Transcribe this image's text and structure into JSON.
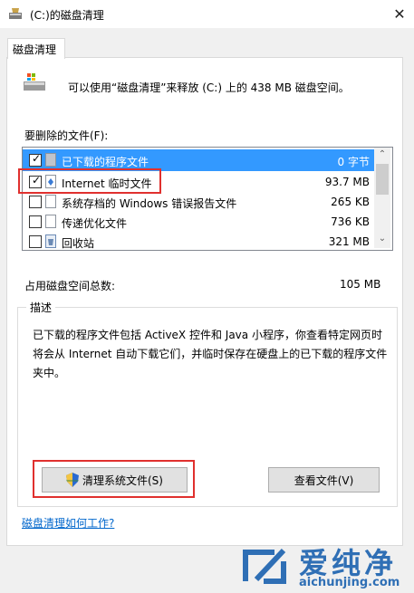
{
  "window": {
    "title": "(C:)的磁盘清理",
    "close_glyph": "✕"
  },
  "tab": {
    "label": "磁盘清理"
  },
  "header": {
    "text": "可以使用“磁盘清理”来释放  (C:) 上的 438 MB 磁盘空间。"
  },
  "files": {
    "label": "要删除的文件(F):",
    "rows": [
      {
        "name": "已下载的程序文件",
        "size": "0 字节",
        "checked": true,
        "selected": true
      },
      {
        "name": "Internet 临时文件",
        "size": "93.7 MB",
        "checked": true,
        "selected": false
      },
      {
        "name": "系统存档的 Windows 错误报告文件",
        "size": "265 KB",
        "checked": false,
        "selected": false
      },
      {
        "name": "传递优化文件",
        "size": "736 KB",
        "checked": false,
        "selected": false
      },
      {
        "name": "回收站",
        "size": "321 MB",
        "checked": false,
        "selected": false
      }
    ]
  },
  "total": {
    "label": "占用磁盘空间总数:",
    "value": "105 MB"
  },
  "description": {
    "title": "描述",
    "text": "已下载的程序文件包括 ActiveX 控件和 Java 小程序，你查看特定网页时将会从 Internet 自动下载它们，并临时保存在硬盘上的已下载的程序文件夹中。"
  },
  "buttons": {
    "clean_system": "清理系统文件(S)",
    "view_files": "查看文件(V)"
  },
  "link": {
    "text": "磁盘清理如何工作?"
  },
  "watermark": {
    "name": "爱纯净",
    "url": "aichunjing.com"
  },
  "colors": {
    "highlight": "#e0302e",
    "selection": "#3399ff",
    "link": "#0066cc"
  }
}
